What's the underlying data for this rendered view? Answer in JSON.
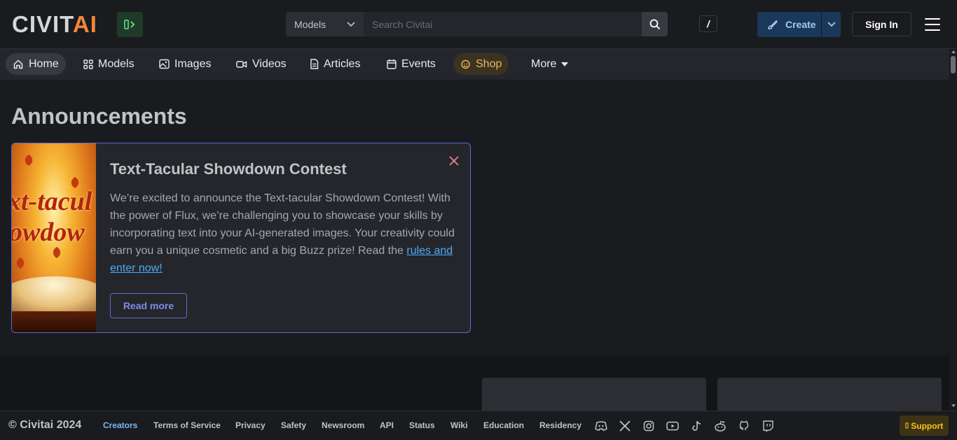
{
  "header": {
    "logo_civit": "CIVIT",
    "logo_ai": "AI",
    "search": {
      "category": "Models",
      "placeholder": "Search Civitai",
      "shortcut": "/"
    },
    "create_label": "Create",
    "signin_label": "Sign In"
  },
  "nav": {
    "items": [
      {
        "label": "Home",
        "icon": "home-icon"
      },
      {
        "label": "Models",
        "icon": "grid-icon"
      },
      {
        "label": "Images",
        "icon": "image-icon"
      },
      {
        "label": "Videos",
        "icon": "video-icon"
      },
      {
        "label": "Articles",
        "icon": "file-text-icon"
      },
      {
        "label": "Events",
        "icon": "calendar-icon"
      },
      {
        "label": "Shop",
        "icon": "shop-icon"
      },
      {
        "label": "More",
        "icon": "caret-down-icon"
      }
    ]
  },
  "main": {
    "title": "Announcements",
    "announcement": {
      "image_words": [
        "xt-tacul",
        "owdow"
      ],
      "title": "Text-Tacular Showdown Contest",
      "text": "We’re excited to announce the Text-tacular Showdown Contest! With the power of Flux, we’re challenging you to showcase your skills by incorporating text into your AI-generated images. Your creativity could earn you a unique cosmetic and a big Buzz prize! Read the ",
      "link_text": "rules and enter now!",
      "read_more_label": "Read more"
    }
  },
  "footer": {
    "copyright": "© Civitai 2024",
    "links": [
      "Creators",
      "Terms of Service",
      "Privacy",
      "Safety",
      "Newsroom",
      "API",
      "Status",
      "Wiki",
      "Education",
      "Residency"
    ],
    "social_icons": [
      "discord-icon",
      "x-icon",
      "instagram-icon",
      "youtube-icon",
      "tiktok-icon",
      "reddit-icon",
      "github-icon",
      "twitch-icon"
    ],
    "support_label": "Support"
  },
  "colors": {
    "background": "#1a1b1e",
    "accent_blue": "#5c6bd0",
    "logo_orange": "#f0863a",
    "support_yellow": "#fcc419"
  }
}
